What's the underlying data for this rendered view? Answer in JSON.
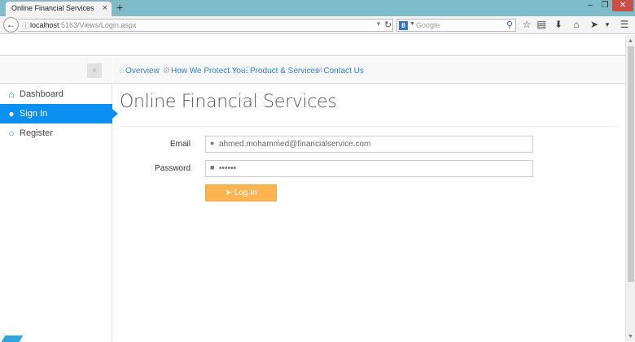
{
  "browser": {
    "tab_title": "Online Financial Services",
    "tab_close": "×",
    "new_tab": "+",
    "url_host": "localhost",
    "url_path": ":5163/Views/Login.aspx",
    "search_placeholder": "Google",
    "search_engine_badge": "8"
  },
  "sidebar": {
    "items": [
      {
        "label": "Dashboard",
        "icon": "home-icon",
        "active": false
      },
      {
        "label": "Sign In",
        "icon": "user-icon",
        "active": true
      },
      {
        "label": "Register",
        "icon": "users-icon",
        "active": false
      }
    ]
  },
  "breadcrumb": {
    "items": [
      {
        "label": "Overview",
        "icon": "home-icon"
      },
      {
        "label": "How We Protect You",
        "icon": "key-icon"
      },
      {
        "label": "Product & Services",
        "icon": "cart-icon"
      },
      {
        "label": "Contact Us",
        "icon": "paperclip-icon"
      }
    ],
    "separator": "/"
  },
  "page": {
    "title": "Online Financial Services"
  },
  "form": {
    "email_label": "Email",
    "email_value": "ahmed.mohammed@financialservice.com",
    "password_label": "Password",
    "password_value": "••••••",
    "login_label": "Log In"
  },
  "colors": {
    "accent": "#0b8ff0",
    "button": "#fbb450",
    "link": "#2b7fd0"
  }
}
